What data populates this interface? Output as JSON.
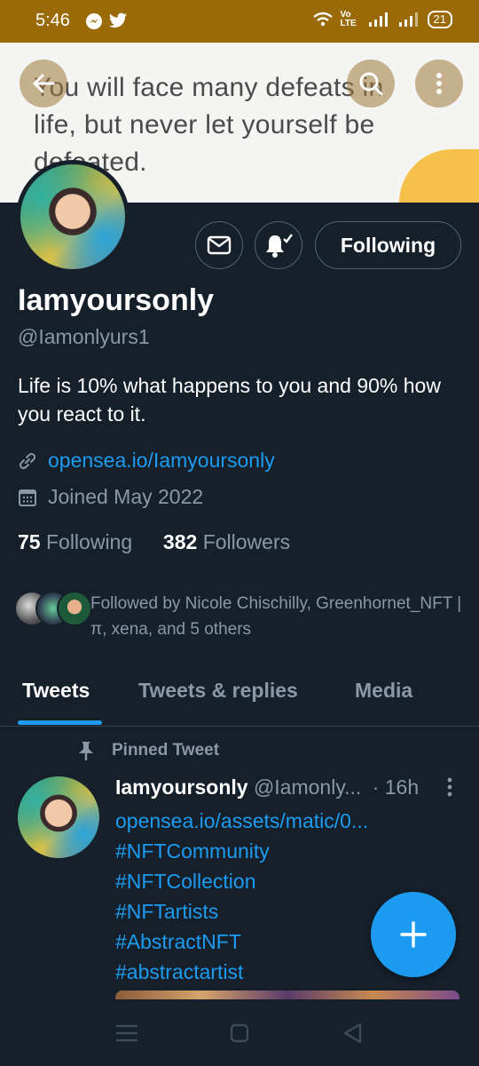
{
  "status_bar": {
    "time": "5:46",
    "network_label": "Vo LTE",
    "battery": "21"
  },
  "banner": {
    "quote": "You will face many defeats in life, but never let yourself be defeated."
  },
  "actions": {
    "following_label": "Following"
  },
  "profile": {
    "name": "Iamyoursonly",
    "handle": "@Iamonlyurs1",
    "bio": "Life is 10% what happens to you and 90% how you react to it.",
    "website": "opensea.io/Iamyoursonly",
    "joined": "Joined May 2022",
    "following_count": "75",
    "following_label": "Following",
    "followers_count": "382",
    "followers_label": "Followers",
    "followed_by": "Followed by Nicole Chischilly, Greenhornet_NFT |π, xena, and 5 others"
  },
  "tabs": [
    {
      "label": "Tweets",
      "active": true
    },
    {
      "label": "Tweets & replies",
      "active": false
    },
    {
      "label": "Media",
      "active": false
    }
  ],
  "pinned_tweet": {
    "pinned_label": "Pinned Tweet",
    "author_name": "Iamyoursonly",
    "author_handle": "@Iamonly...",
    "time": "· 16h",
    "lines": [
      "opensea.io/assets/matic/0...",
      "#NFTCommunity",
      "#NFTCollection",
      "#NFTartists",
      "#AbstractNFT",
      "#abstractartist"
    ]
  },
  "colors": {
    "accent": "#1d9bf0",
    "background": "#15202b",
    "status_bar": "#9b6a08",
    "secondary_text": "#8b98a5"
  }
}
